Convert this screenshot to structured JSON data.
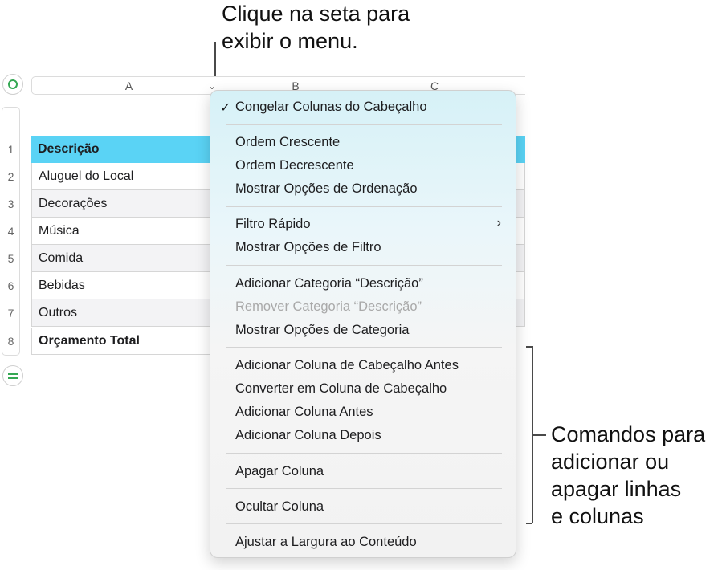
{
  "callouts": {
    "top": "Clique na seta para\nexibir o menu.",
    "right": "Comandos para\nadicionar ou\napagar linhas\ne colunas"
  },
  "columns": [
    "A",
    "B",
    "C"
  ],
  "rows": {
    "numbers": [
      "1",
      "2",
      "3",
      "4",
      "5",
      "6",
      "7",
      "8"
    ],
    "header": "Descrição",
    "body": [
      "Aluguel do Local",
      "Decorações",
      "Música",
      "Comida",
      "Bebidas",
      "Outros"
    ],
    "footer": "Orçamento Total"
  },
  "menu": {
    "items": [
      {
        "label": "Congelar Colunas do Cabeçalho",
        "checked": true
      },
      {
        "label": "Ordem Crescente"
      },
      {
        "label": "Ordem Decrescente"
      },
      {
        "label": "Mostrar Opções de Ordenação"
      },
      {
        "label": "Filtro Rápido",
        "submenu": true
      },
      {
        "label": "Mostrar Opções de Filtro"
      },
      {
        "label": "Adicionar Categoria “Descrição”"
      },
      {
        "label": "Remover Categoria “Descrição”",
        "disabled": true
      },
      {
        "label": "Mostrar Opções de Categoria"
      },
      {
        "label": "Adicionar Coluna de Cabeçalho Antes"
      },
      {
        "label": "Converter em Coluna de Cabeçalho"
      },
      {
        "label": "Adicionar Coluna Antes"
      },
      {
        "label": "Adicionar Coluna Depois"
      },
      {
        "label": "Apagar Coluna"
      },
      {
        "label": "Ocultar Coluna"
      },
      {
        "label": "Ajustar a Largura ao Conteúdo"
      }
    ],
    "check_glyph": "✓",
    "chevron_glyph": "›"
  },
  "colors": {
    "header_fill": "#5ad3f5",
    "accent_green": "#34a853",
    "footer_rule": "#2a8fd0"
  }
}
